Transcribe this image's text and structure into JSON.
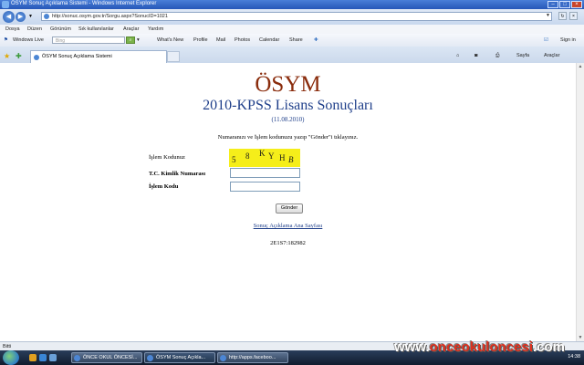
{
  "window": {
    "title": "ÖSYM Sonuç Açıklama Sistemi - Windows Internet Explorer"
  },
  "address": {
    "url": "http://sonuc.osym.gov.tr/Sorgu.aspx?SonucID=1021"
  },
  "menu": [
    "Dosya",
    "Düzen",
    "Görünüm",
    "Sık kullanılanlar",
    "Araçlar",
    "Yardım"
  ],
  "links": {
    "windows_live": "Windows Live",
    "bing_placeholder": "Bing",
    "items": [
      "What's New",
      "Profile",
      "Mail",
      "Photos",
      "Calendar",
      "Share"
    ],
    "signin": "Sign in"
  },
  "tab": {
    "label": "ÖSYM Sonuç Açıklama Sistemi"
  },
  "commands": {
    "page": "Sayfa",
    "tools": "Araçlar"
  },
  "page": {
    "brand": "ÖSYM",
    "title": "2010-KPSS Lisans Sonuçları",
    "date": "(11.08.2010)",
    "instruction": "Numaranızı ve İşlem kodunuzu yazıp \"Gönder\"i tıklayınız.",
    "captcha_label": "İşlem Kodunuz",
    "captcha_chars": [
      "5",
      "8",
      "K",
      "Y",
      "H",
      "B"
    ],
    "tc_label": "T.C. Kimlik Numarası",
    "code_label": "İşlem Kodu",
    "tc_value": "",
    "code_value": "",
    "submit": "Gönder",
    "home_link": "Sonuç Açıklama Ana Sayfası",
    "session_code": "2E1S7:182982"
  },
  "status": {
    "text": "Bitti"
  },
  "taskbar": {
    "tasks": [
      "ÖNCE OKUL ÖNCESİ...",
      "ÖSYM Sonuç Açıkla...",
      "http://apps.faceboo..."
    ],
    "clock": "14:38"
  },
  "watermark": {
    "left": "www.",
    "mid": "onceokuloncesi",
    "right": ".com"
  },
  "colors": {
    "brand": "#8a2c0c",
    "title": "#1f3f8a",
    "captcha_bg": "#f5ee1a"
  }
}
